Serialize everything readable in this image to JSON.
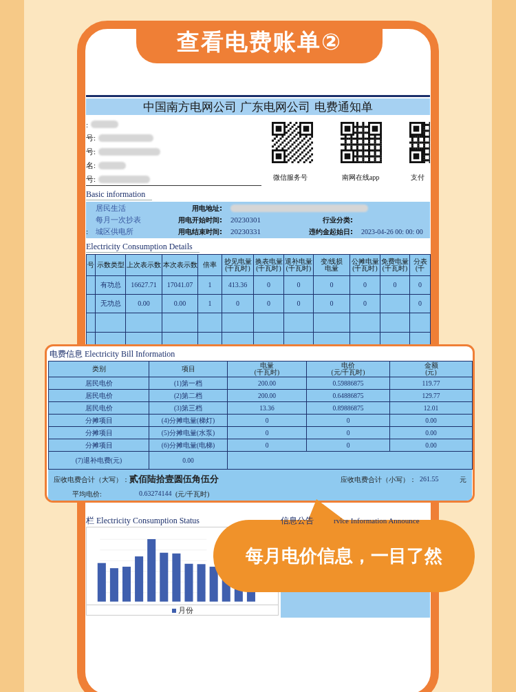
{
  "banner": {
    "title": "查看电费账单②"
  },
  "bill": {
    "title": "中国南方电网公司 广东电网公司 电费通知单",
    "customer_fields": [
      {
        "label": ":"
      },
      {
        "label": "号:"
      },
      {
        "label": "号:"
      },
      {
        "label": "名:"
      },
      {
        "label": "号:"
      }
    ],
    "qr_codes": [
      {
        "caption": "微信服务号"
      },
      {
        "caption": "南网在线app"
      },
      {
        "caption": "支付"
      }
    ],
    "basic_info": {
      "heading": "Basic information",
      "rows": [
        {
          "category": "居民生活",
          "label": "用电地址:",
          "value_redacted": true
        },
        {
          "category": "每月一次抄表",
          "label": "用电开始时间:",
          "value": "20230301",
          "label2": "行业分类:"
        },
        {
          "prefix": ":",
          "category": "城区供电所",
          "label": "用电结束时间:",
          "value": "20230331",
          "label2": "违约金起始日:",
          "value2": "2023-04-26 00: 00: 00"
        }
      ]
    },
    "consumption": {
      "heading": "Electricity Consumption Details",
      "columns": [
        {
          "line_1": "号"
        },
        {
          "line_1": "示数类型"
        },
        {
          "line_1": "上次表示数"
        },
        {
          "line_1": "本次表示数"
        },
        {
          "line_1": "倍率"
        },
        {
          "line_1": "抄见电量",
          "line_2": "(千瓦时)"
        },
        {
          "line_1": "换表电量",
          "line_2": "(千瓦时)"
        },
        {
          "line_1": "退补电量",
          "line_2": "(千瓦时)"
        },
        {
          "line_1": "变/线损",
          "line_2": "电量"
        },
        {
          "line_1": "公摊电量",
          "line_2": "(千瓦时)"
        },
        {
          "line_1": "免费电量",
          "line_2": "(千瓦时)"
        },
        {
          "line_1": "分表",
          "line_2": "(千"
        }
      ],
      "rows": [
        [
          null,
          "有功总",
          "16627.71",
          "17041.07",
          "1",
          "413.36",
          "0",
          "0",
          "0",
          "0",
          "0",
          "0"
        ],
        [
          null,
          "无功总",
          "0.00",
          "0.00",
          "1",
          "0",
          "0",
          "0",
          "0",
          "0",
          null,
          "0"
        ]
      ]
    },
    "status": {
      "heading": "栏 Electricity Consumption Status",
      "legend": "月份"
    },
    "announcement": {
      "heading": "信息公告",
      "heading_en": "rvice Information Announce"
    }
  },
  "bill_info": {
    "title": "电费信息 Electricity Bill Information",
    "columns": [
      {
        "line_1": "类别"
      },
      {
        "line_1": "项目"
      },
      {
        "line_1": "电量",
        "line_2": "(千瓦时)"
      },
      {
        "line_1": "电价",
        "line_2": "(元/千瓦时)"
      },
      {
        "line_1": "金额",
        "line_2": "(元)"
      }
    ],
    "rows": [
      [
        "居民电价",
        "(1)第一档",
        "200.00",
        "0.59886875",
        "119.77"
      ],
      [
        "居民电价",
        "(2)第二档",
        "200.00",
        "0.64886875",
        "129.77"
      ],
      [
        "居民电价",
        "(3)第三档",
        "13.36",
        "0.89886875",
        "12.01"
      ],
      [
        "分摊项目",
        "(4)分摊电量(梯灯)",
        "0",
        "0",
        "0.00"
      ],
      [
        "分摊项目",
        "(5)分摊电量(水泵)",
        "0",
        "0",
        "0.00"
      ],
      [
        "分摊项目",
        "(6)分摊电量(电梯)",
        "0",
        "0",
        "0.00"
      ]
    ],
    "refund": {
      "label": "(7)退补电费(元)",
      "value": "0.00"
    },
    "total_words_label": "应收电费合计（大写）：",
    "total_words": "贰佰陆拾壹圆伍角伍分",
    "total_label": "应收电费合计（小写）：",
    "total": "261.55",
    "total_unit": "元",
    "avg_label": "平均电价:",
    "avg_value": "0.63274144",
    "avg_unit": "(元/千瓦时)"
  },
  "callout": {
    "text": "每月电价信息，一目了然"
  }
}
